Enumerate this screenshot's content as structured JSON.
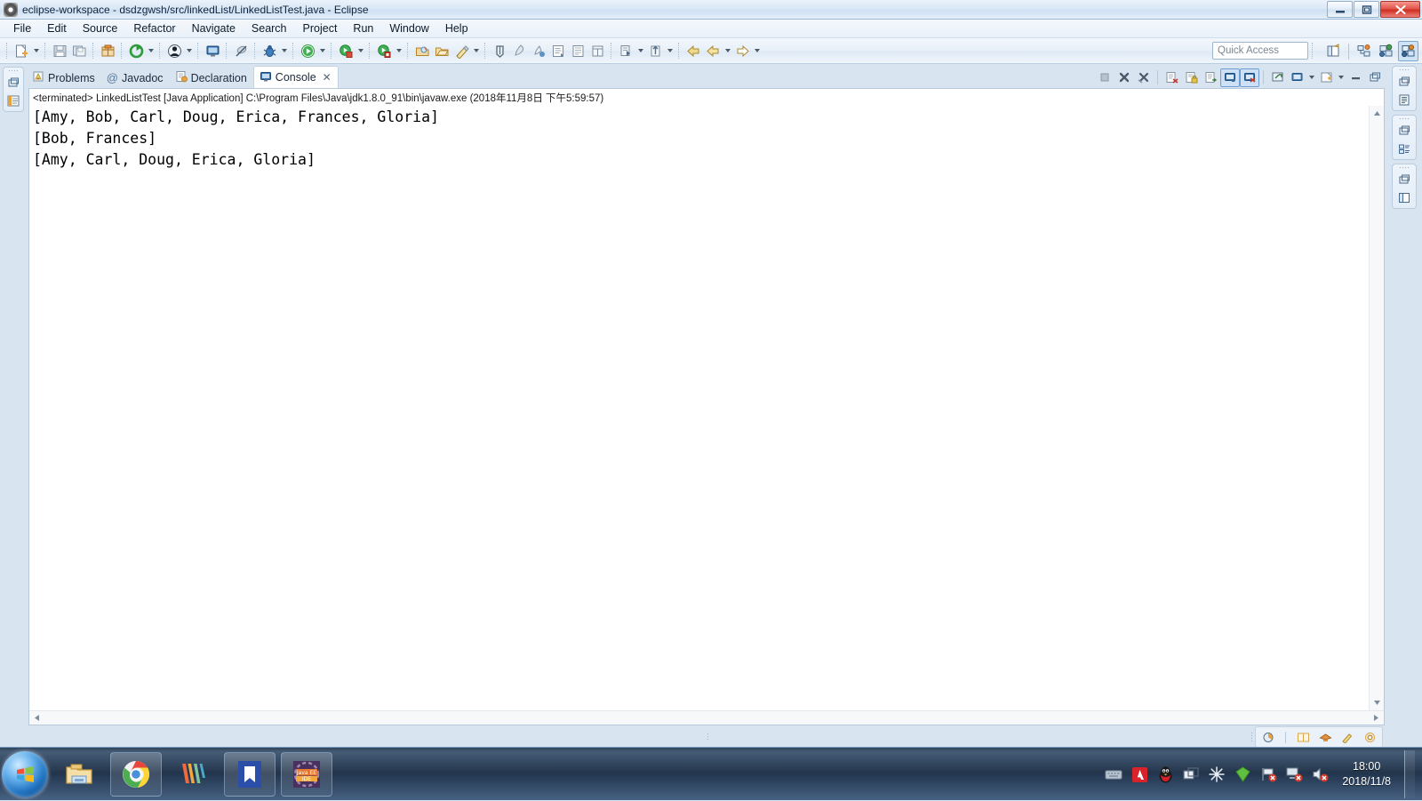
{
  "window": {
    "title": "eclipse-workspace - dsdzgwsh/src/linkedList/LinkedListTest.java - Eclipse",
    "app_icon": "eclipse-icon",
    "minimize_label": "Minimize",
    "restore_label": "Restore",
    "close_label": "Close"
  },
  "menu": {
    "items": [
      {
        "label": "File"
      },
      {
        "label": "Edit"
      },
      {
        "label": "Source"
      },
      {
        "label": "Refactor"
      },
      {
        "label": "Navigate"
      },
      {
        "label": "Search"
      },
      {
        "label": "Project"
      },
      {
        "label": "Run"
      },
      {
        "label": "Window"
      },
      {
        "label": "Help"
      }
    ]
  },
  "toolbar": {
    "buttons": [
      {
        "name": "new-wizard",
        "icon": "new-file-icon",
        "dropdown": true
      },
      {
        "name": "save",
        "icon": "save-icon",
        "dropdown": false
      },
      {
        "name": "save-all",
        "icon": "save-all-icon",
        "dropdown": false
      },
      {
        "name": "new-java-package",
        "icon": "package-icon",
        "dropdown": false
      },
      {
        "name": "refresh-build",
        "icon": "build-icon",
        "dropdown": true
      },
      {
        "name": "open-type",
        "icon": "open-type-icon",
        "dropdown": true
      },
      {
        "name": "open-console",
        "icon": "console-icon",
        "dropdown": false
      },
      {
        "name": "skip-breakpoints",
        "icon": "skip-breakpoints-icon",
        "dropdown": false
      },
      {
        "name": "debug",
        "icon": "debug-bug-icon",
        "dropdown": true
      },
      {
        "name": "run",
        "icon": "run-play-icon",
        "dropdown": true
      },
      {
        "name": "run-external-tools",
        "icon": "external-tools-icon",
        "dropdown": true
      },
      {
        "name": "coverage",
        "icon": "coverage-icon",
        "dropdown": true
      },
      {
        "name": "new-java-project",
        "icon": "java-project-icon",
        "dropdown": false
      },
      {
        "name": "new-package",
        "icon": "new-package-icon",
        "dropdown": false
      },
      {
        "name": "new-class",
        "icon": "new-class-icon",
        "dropdown": true
      },
      {
        "name": "search",
        "icon": "search-icon",
        "dropdown": false
      },
      {
        "name": "annotation",
        "icon": "annotation-icon",
        "dropdown": false
      },
      {
        "name": "next-annotation",
        "icon": "next-annotation-icon",
        "dropdown": false
      },
      {
        "name": "toggle-mark-occurrences",
        "icon": "mark-occurrences-icon",
        "dropdown": false
      },
      {
        "name": "toggle-block-selection",
        "icon": "block-selection-icon",
        "dropdown": false
      },
      {
        "name": "toggle-whitespace",
        "icon": "whitespace-icon",
        "dropdown": false
      },
      {
        "name": "previous-edit-location",
        "icon": "prev-edit-icon",
        "dropdown": true
      },
      {
        "name": "next-edit-location",
        "icon": "next-edit-icon",
        "dropdown": true
      },
      {
        "name": "back",
        "icon": "back-arrow-icon",
        "dropdown": false
      },
      {
        "name": "forward-history",
        "icon": "forward-arrow-icon",
        "dropdown": true
      },
      {
        "name": "forward",
        "icon": "forward-arrow2-icon",
        "dropdown": true
      }
    ],
    "quick_access_placeholder": "Quick Access",
    "perspectives": [
      {
        "name": "open-perspective",
        "icon": "open-perspective-icon",
        "active": false
      },
      {
        "name": "perspective-java-browsing",
        "icon": "java-browsing-icon",
        "active": false
      },
      {
        "name": "perspective-debug",
        "icon": "debug-perspective-icon",
        "active": false
      },
      {
        "name": "perspective-java-ee",
        "icon": "java-ee-perspective-icon",
        "active": true
      }
    ]
  },
  "left_fast_view": {
    "items": [
      {
        "name": "package-explorer",
        "icon": "package-explorer-icon"
      }
    ],
    "restore_icon": "restore-view-icon"
  },
  "right_fast_view": {
    "stacks": [
      {
        "restore_icon": "restore-view-icon",
        "name": "outline-stack",
        "icon": "outline-icon"
      },
      {
        "restore_icon": "restore-view-icon",
        "name": "task-list-stack",
        "icon": "task-list-icon"
      },
      {
        "restore_icon": "restore-view-icon",
        "name": "templates-stack",
        "icon": "templates-icon"
      }
    ]
  },
  "view_tabs": [
    {
      "label": "Problems",
      "icon": "problems-icon",
      "active": false,
      "closable": false
    },
    {
      "label": "Javadoc",
      "icon": "javadoc-at-icon",
      "active": false,
      "closable": false
    },
    {
      "label": "Declaration",
      "icon": "declaration-icon",
      "active": false,
      "closable": false
    },
    {
      "label": "Console",
      "icon": "console-tab-icon",
      "active": true,
      "closable": true
    }
  ],
  "console_toolbar": [
    {
      "name": "terminate",
      "icon": "terminate-icon",
      "toggled": false,
      "enabled": false
    },
    {
      "name": "remove-launch",
      "icon": "remove-icon",
      "toggled": false,
      "enabled": true
    },
    {
      "name": "remove-all-terminated",
      "icon": "remove-all-icon",
      "toggled": false,
      "enabled": true
    },
    {
      "name": "clear-console",
      "icon": "clear-console-icon",
      "toggled": false,
      "enabled": true
    },
    {
      "name": "scroll-lock",
      "icon": "scroll-lock-icon",
      "toggled": false,
      "enabled": true
    },
    {
      "name": "word-wrap",
      "icon": "word-wrap-icon",
      "toggled": false,
      "enabled": true
    },
    {
      "name": "show-console-on-output",
      "icon": "show-on-output-icon",
      "toggled": true,
      "enabled": true
    },
    {
      "name": "show-console-on-error",
      "icon": "show-on-error-icon",
      "toggled": true,
      "enabled": true
    },
    {
      "name": "pin-console",
      "icon": "pin-icon",
      "toggled": false,
      "enabled": true
    },
    {
      "name": "display-selected-console",
      "icon": "display-console-icon",
      "toggled": false,
      "enabled": true
    },
    {
      "name": "open-console",
      "icon": "open-console-icon",
      "toggled": false,
      "enabled": true
    },
    {
      "name": "minimize-view",
      "icon": "minimize-icon",
      "toggled": false,
      "enabled": true
    },
    {
      "name": "maximize-view",
      "icon": "maximize-icon",
      "toggled": false,
      "enabled": true
    }
  ],
  "console": {
    "process_line": "<terminated> LinkedListTest [Java Application] C:\\Program Files\\Java\\jdk1.8.0_91\\bin\\javaw.exe (2018年11月8日 下午5:59:57)",
    "output_lines": [
      "[Amy, Bob, Carl, Doug, Erica, Frances, Gloria]",
      "[Bob, Frances]",
      "[Amy, Carl, Doug, Erica, Gloria]"
    ]
  },
  "statusbar": {
    "tray_icons": [
      {
        "name": "heap-status-icon"
      },
      {
        "name": "tip-of-day-icon"
      },
      {
        "name": "marketplace-icon"
      },
      {
        "name": "edit-icon"
      },
      {
        "name": "error-log-icon"
      }
    ]
  },
  "taskbar": {
    "start_label": "Start",
    "items": [
      {
        "name": "windows-explorer",
        "icon": "folder-icon",
        "active": false
      },
      {
        "name": "google-chrome",
        "icon": "chrome-icon",
        "active": true
      },
      {
        "name": "media-app",
        "icon": "stripes-icon",
        "active": false
      },
      {
        "name": "wps-writer",
        "icon": "w-document-icon",
        "active": false
      },
      {
        "name": "eclipse-java-ee-ide",
        "icon": "java-ee-ide-icon",
        "active": true
      }
    ],
    "tray": [
      {
        "name": "input-method-icon"
      },
      {
        "name": "adobe-icon"
      },
      {
        "name": "qq-penguin-icon"
      },
      {
        "name": "window-manager-icon"
      },
      {
        "name": "snowflake-icon"
      },
      {
        "name": "green-shield-icon"
      },
      {
        "name": "flag-error-icon"
      },
      {
        "name": "network-error-icon"
      },
      {
        "name": "volume-mute-icon"
      }
    ],
    "clock_time": "18:00",
    "clock_date": "2018/11/8"
  },
  "colors": {
    "accent": "#1f72c0",
    "titlebar": "#dbe8f6",
    "console_bg": "#ffffff",
    "console_text": "#000000",
    "taskbar": "#1a2e48"
  }
}
